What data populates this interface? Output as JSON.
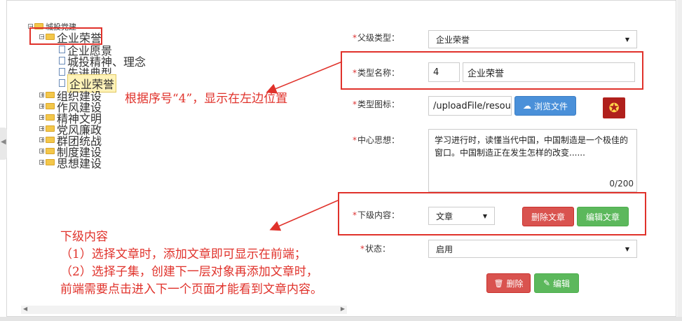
{
  "tree": {
    "root": "城投党建",
    "selected_group": "企业荣誉",
    "children_of_selected": [
      "企业愿景",
      "城投精神、理念",
      "先进典型",
      "企业荣誉"
    ],
    "other_groups": [
      "组织建设",
      "作风建设",
      "精神文明",
      "党风廉政",
      "群团统战",
      "制度建设",
      "思想建设"
    ]
  },
  "annotations": {
    "top_note": "根据序号“4”，显示在左边位置",
    "bottom_note": [
      "下级内容",
      "（1）选择文章时，添加文章即可显示在前端；",
      "（2）选择子集，创建下一层对象再添加文章时，",
      "前端需要点击进入下一个页面才能看到文章内容。"
    ]
  },
  "form": {
    "parent_type": {
      "label": "父级类型：",
      "value": "企业荣誉"
    },
    "type_name": {
      "label": "类型名称：",
      "order": "4",
      "value": "企业荣誉"
    },
    "type_icon": {
      "label": "类型图标：",
      "path": "/uploadFile/resour",
      "browse_label": "浏览文件"
    },
    "center_idea": {
      "label": "中心思想：",
      "text": "学习进行时，读懂当代中国，中国制造是一个极佳的窗口。中国制造正在发生怎样的改变......",
      "counter": "0/200"
    },
    "sub_content": {
      "label": "下级内容：",
      "value": "文章",
      "delete_article": "删除文章",
      "edit_article": "编辑文章"
    },
    "status": {
      "label": "状态：",
      "value": "启用"
    },
    "delete_label": "删除",
    "edit_label": "编辑"
  },
  "colors": {
    "annotation_red": "#e0322b",
    "primary_blue": "#4a90d9",
    "danger_red": "#d9534f",
    "success_green": "#5cb85c"
  }
}
